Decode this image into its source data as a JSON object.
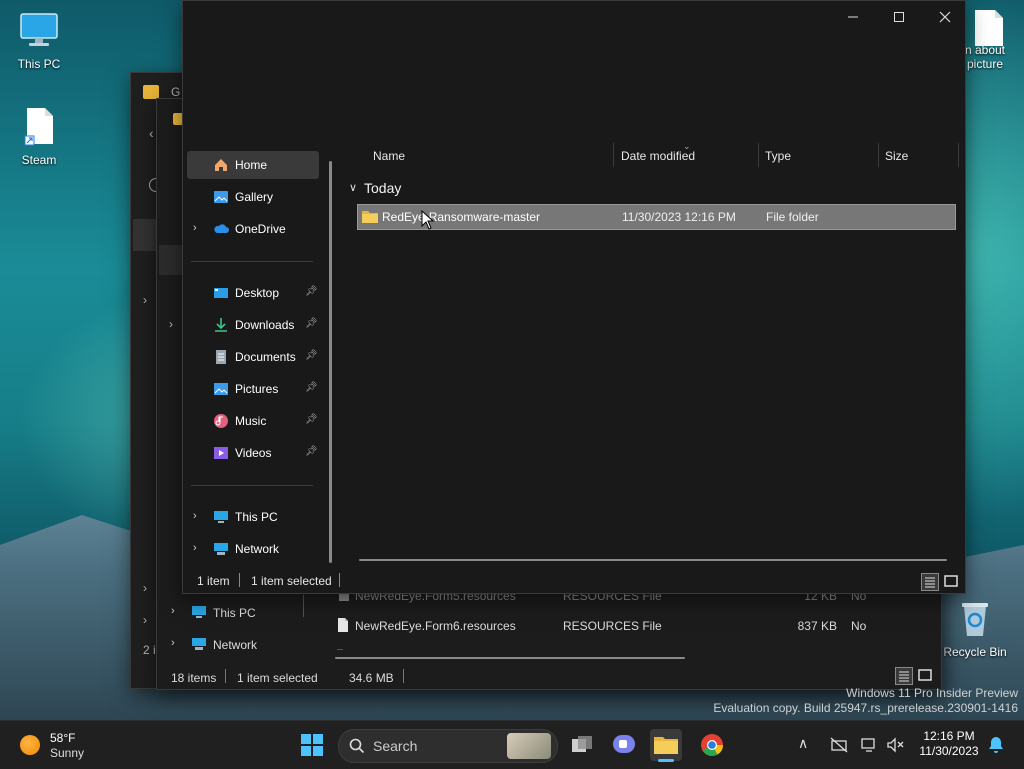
{
  "desktop": {
    "icons": [
      {
        "label": "This PC"
      },
      {
        "label": "Steam"
      },
      {
        "label": "n about"
      },
      {
        "label": "picture"
      },
      {
        "label": "Recycle Bin"
      }
    ],
    "watermark_line1": "Windows 11 Pro Insider Preview",
    "watermark_line2": "Evaluation copy. Build 25947.rs_prerelease.230901-1416"
  },
  "back_window": {
    "rows": [
      {
        "name": "NewRedEye.Form5.resources",
        "type": "RESOURCES File",
        "size": "12 KB",
        "flag": "No"
      },
      {
        "name": "NewRedEye.Form6.resources",
        "type": "RESOURCES File",
        "size": "837 KB",
        "flag": "No"
      }
    ],
    "nav": [
      {
        "label": "This PC"
      },
      {
        "label": "Network"
      }
    ],
    "status_count": "18 items",
    "status_selected": "1 item selected",
    "status_size": "34.6 MB",
    "left_trunc": "2 i"
  },
  "front_window": {
    "nav": {
      "home": "Home",
      "gallery": "Gallery",
      "onedrive": "OneDrive",
      "desktop": "Desktop",
      "downloads": "Downloads",
      "documents": "Documents",
      "pictures": "Pictures",
      "music": "Music",
      "videos": "Videos",
      "thispc": "This PC",
      "network": "Network"
    },
    "columns": {
      "name": "Name",
      "date": "Date modified",
      "type": "Type",
      "size": "Size"
    },
    "group": "Today",
    "row": {
      "name": "RedEye-Ransomware-master",
      "date": "11/30/2023 12:16 PM",
      "type": "File folder"
    },
    "status_count": "1 item",
    "status_selected": "1 item selected"
  },
  "taskbar": {
    "weather_temp": "58°F",
    "weather_desc": "Sunny",
    "search_label": "Search",
    "time": "12:16 PM",
    "date": "11/30/2023"
  },
  "colors": {
    "accent": "#0078d4",
    "folder": "#e8b53a",
    "selection": "#777777"
  }
}
